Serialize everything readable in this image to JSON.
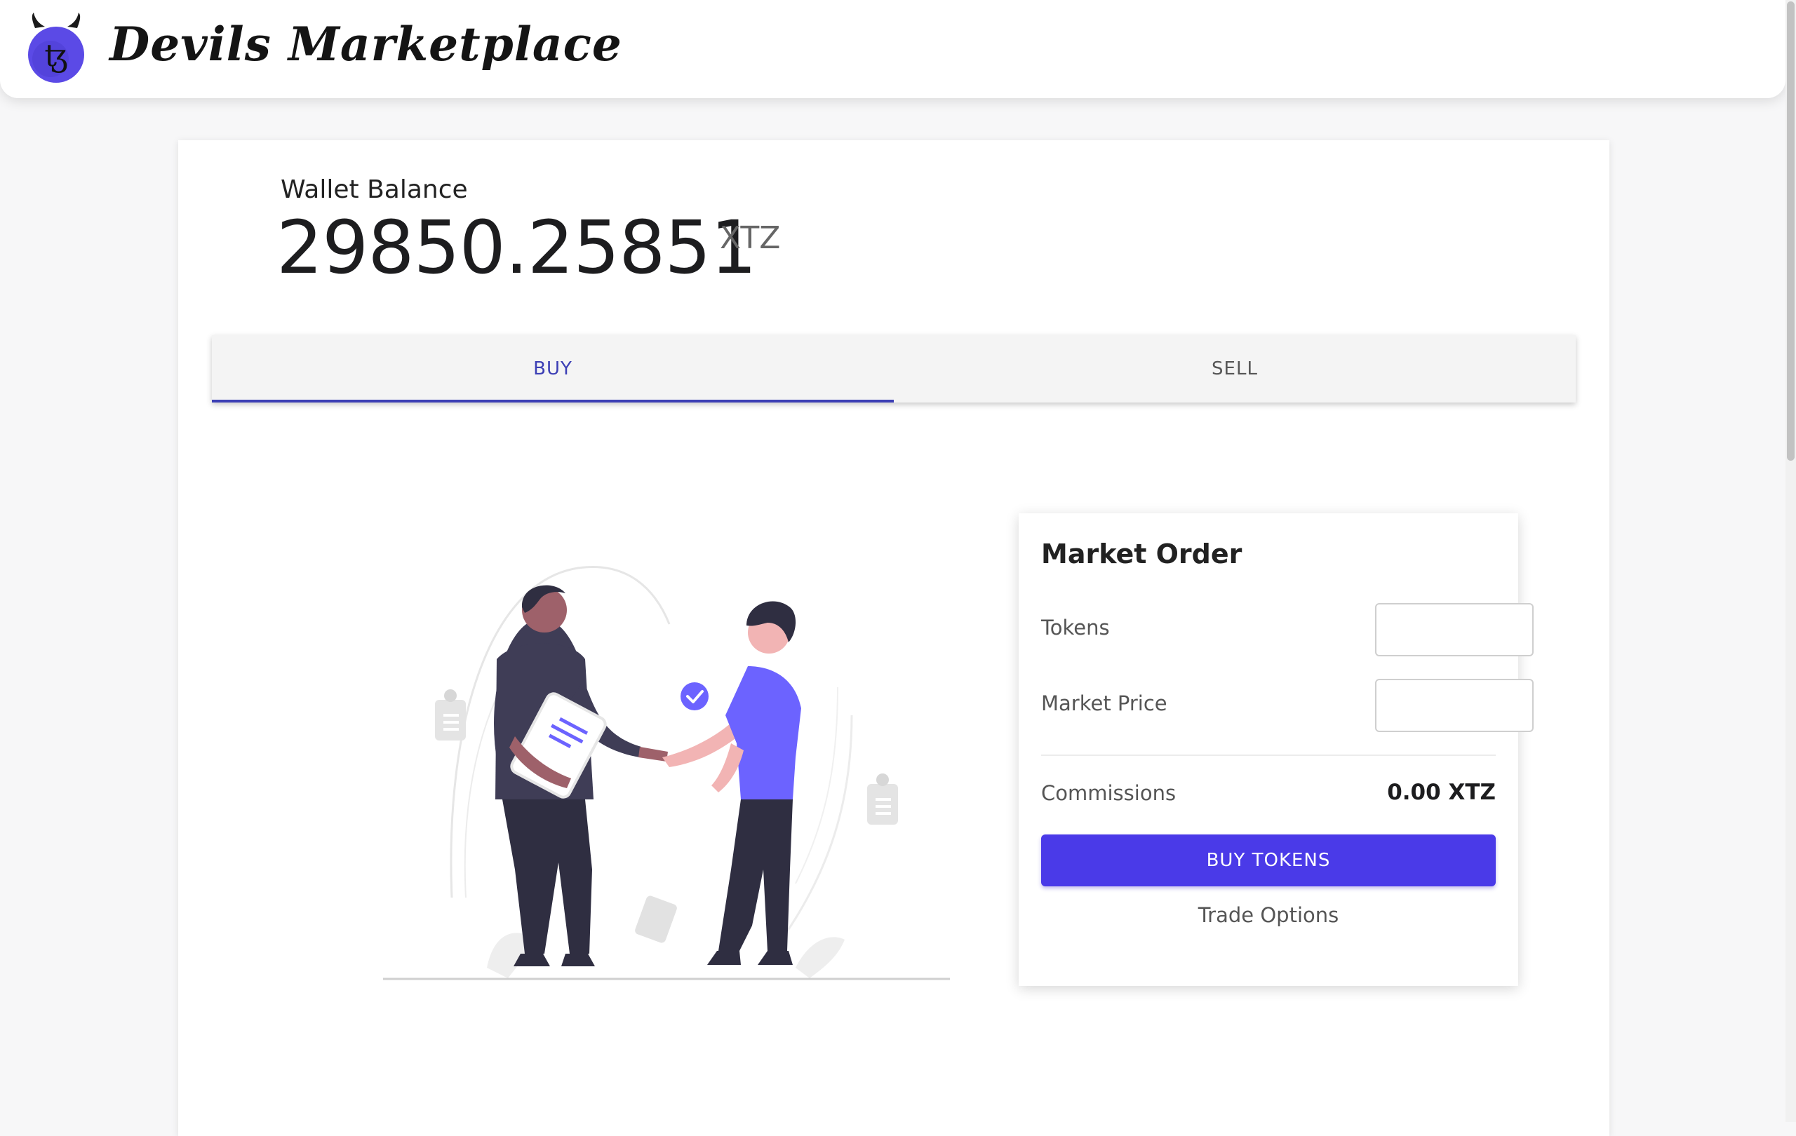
{
  "app": {
    "brand": "Devils Marketplace",
    "logo_icon": "devil-tezos-icon",
    "accent_color": "#4a3ae8"
  },
  "wallet": {
    "label": "Wallet Balance",
    "amount": "29850.25851",
    "unit": "XTZ"
  },
  "tabs": [
    {
      "label": "BUY",
      "active": true
    },
    {
      "label": "SELL",
      "active": false
    }
  ],
  "illustration": {
    "icon": "handshake-illustration",
    "check_icon": "check-circle-icon"
  },
  "order": {
    "title": "Market Order",
    "tokens_label": "Tokens",
    "tokens_value": "",
    "price_label": "Market Price",
    "price_value": "",
    "commission_label": "Commissions",
    "commission_value": "0.00 XTZ",
    "buy_button": "BUY TOKENS",
    "trade_options": "Trade Options"
  }
}
